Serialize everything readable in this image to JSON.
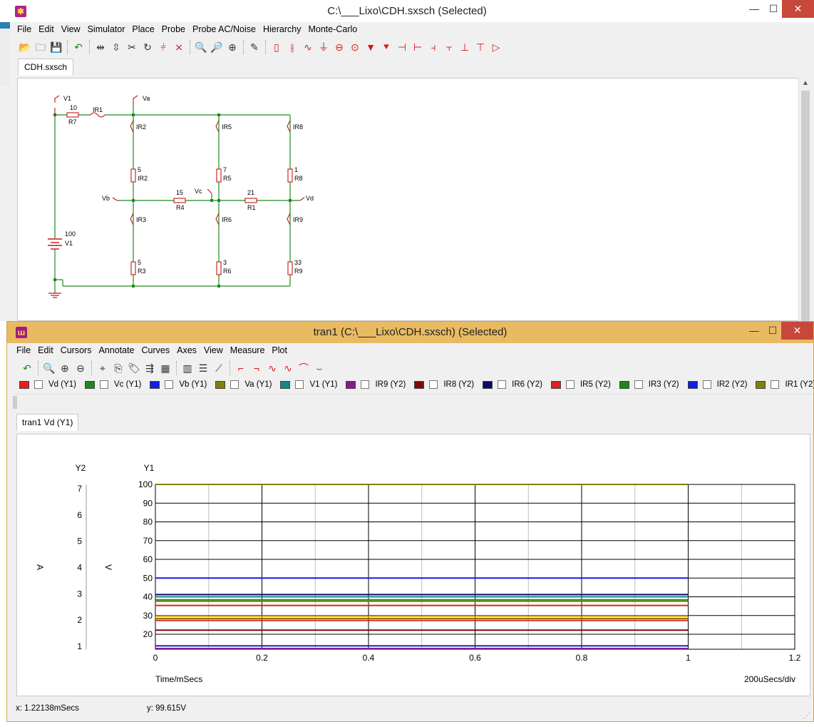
{
  "schematic_window": {
    "title": "C:\\___Lixo\\CDH.sxsch (Selected)",
    "menu": [
      "File",
      "Edit",
      "View",
      "Simulator",
      "Place",
      "Probe",
      "Probe AC/Noise",
      "Hierarchy",
      "Monte-Carlo"
    ],
    "tab": "CDH.sxsch",
    "controls": {
      "minimize": "—",
      "maximize": "☐",
      "close": "✕"
    }
  },
  "schematic": {
    "nets": [
      "V1",
      "Va",
      "Vb",
      "Vc",
      "Vd"
    ],
    "probes": [
      "IR1",
      "IR2",
      "IR5",
      "IR8",
      "IR3",
      "IR6",
      "IR9"
    ],
    "source": {
      "name": "V1",
      "value": "100"
    },
    "resistors": [
      {
        "name": "R7",
        "value": "10"
      },
      {
        "name": "IR2",
        "value": "5"
      },
      {
        "name": "R5",
        "value": "7"
      },
      {
        "name": "R8",
        "value": "1"
      },
      {
        "name": "R4",
        "value": "15"
      },
      {
        "name": "R1",
        "value": "21"
      },
      {
        "name": "R3",
        "value": "5"
      },
      {
        "name": "R6",
        "value": "3"
      },
      {
        "name": "R9",
        "value": "33"
      }
    ]
  },
  "plot_window": {
    "title": "tran1 (C:\\___Lixo\\CDH.sxsch) (Selected)",
    "menu": [
      "File",
      "Edit",
      "Cursors",
      "Annotate",
      "Curves",
      "Axes",
      "View",
      "Measure",
      "Plot"
    ],
    "tab": "tran1 Vd (Y1)",
    "controls": {
      "minimize": "—",
      "maximize": "☐",
      "close": "✕"
    },
    "legend": [
      {
        "label": "Vd (Y1)",
        "color": "#e02020"
      },
      {
        "label": "Vc (Y1)",
        "color": "#1a8a1a"
      },
      {
        "label": "Vb (Y1)",
        "color": "#1020e0"
      },
      {
        "label": "Va (Y1)",
        "color": "#808010"
      },
      {
        "label": "V1 (Y1)",
        "color": "#108a8a"
      },
      {
        "label": "IR9 (Y2)",
        "color": "#8a1a8a"
      },
      {
        "label": "IR8 (Y2)",
        "color": "#7a0a0a"
      },
      {
        "label": "IR6 (Y2)",
        "color": "#0a0a6a"
      },
      {
        "label": "IR5 (Y2)",
        "color": "#e02020"
      },
      {
        "label": "IR3 (Y2)",
        "color": "#1a8a1a"
      },
      {
        "label": "IR2 (Y2)",
        "color": "#1020e0"
      },
      {
        "label": "IR1 (Y2)",
        "color": "#808010"
      }
    ],
    "status": {
      "x": "x: 1.22138mSecs",
      "y": "y: 99.615V"
    }
  },
  "chart_data": {
    "type": "line",
    "xlabel": "Time/mSecs",
    "x_div_label": "200uSecs/div",
    "x_ticks": [
      "0",
      "0.2",
      "0.4",
      "0.6",
      "0.8",
      "1",
      "1.2"
    ],
    "xlim": [
      0,
      1.2
    ],
    "y1": {
      "label": "Y1",
      "unit": "V",
      "ticks": [
        "20",
        "30",
        "40",
        "50",
        "60",
        "70",
        "80",
        "90",
        "100"
      ],
      "ylim": [
        12,
        100
      ]
    },
    "y2": {
      "label": "Y2",
      "unit": "A",
      "ticks": [
        "1",
        "2",
        "3",
        "4",
        "5",
        "6",
        "7"
      ]
    },
    "grid": true,
    "series": [
      {
        "name": "V1 (Y1)",
        "color": "#808010",
        "x": [
          0,
          1
        ],
        "y": [
          100,
          100
        ]
      },
      {
        "name": "Vb (Y1)",
        "color": "#1020e0",
        "x": [
          0,
          1
        ],
        "y": [
          50,
          50
        ]
      },
      {
        "color": "#0a0a6a",
        "x": [
          0,
          1
        ],
        "y": [
          41.2,
          41.2
        ]
      },
      {
        "color": "#108a8a",
        "x": [
          0,
          1
        ],
        "y": [
          40,
          40
        ]
      },
      {
        "color": "#1a8a1a",
        "x": [
          0,
          1
        ],
        "y": [
          38.4,
          38.4
        ]
      },
      {
        "color": "#808010",
        "x": [
          0,
          1
        ],
        "y": [
          37.6,
          37.6
        ]
      },
      {
        "color": "#e02020",
        "x": [
          0,
          1
        ],
        "y": [
          35.4,
          35.4
        ]
      },
      {
        "color": "#e8a010",
        "x": [
          0,
          1
        ],
        "y": [
          29.6,
          29.6
        ]
      },
      {
        "color": "#808010",
        "x": [
          0,
          1
        ],
        "y": [
          28.4,
          28.4
        ]
      },
      {
        "color": "#e02020",
        "x": [
          0,
          1
        ],
        "y": [
          27.4,
          27.4
        ]
      },
      {
        "color": "#7a0a0a",
        "x": [
          0,
          1
        ],
        "y": [
          22.2,
          22.2
        ]
      },
      {
        "color": "#1020e0",
        "x": [
          0,
          1
        ],
        "y": [
          13.8,
          13.8
        ]
      },
      {
        "color": "#8a1a8a",
        "x": [
          0,
          1
        ],
        "y": [
          12.4,
          12.4
        ]
      }
    ]
  }
}
